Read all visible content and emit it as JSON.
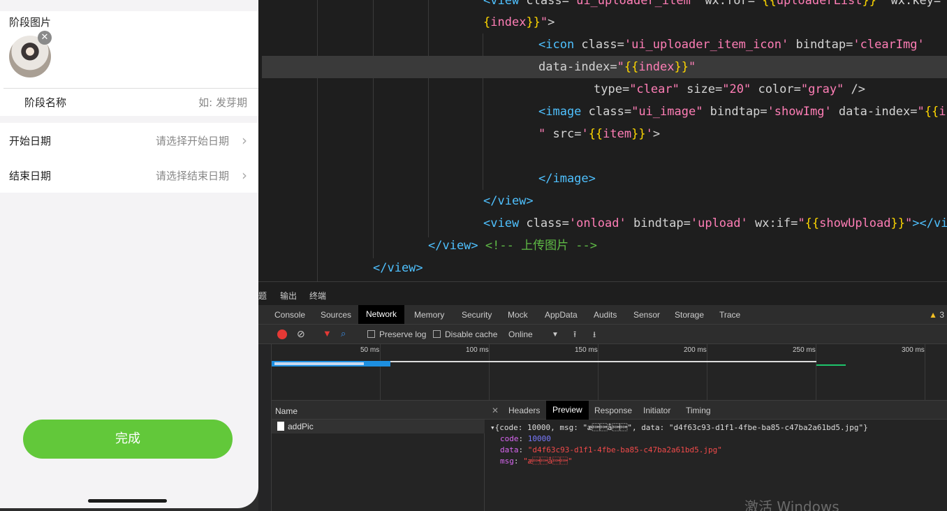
{
  "phone": {
    "stage_pic_label": "阶段图片",
    "avatar_clear_icon": "✕",
    "stage_name_label": "阶段名称",
    "stage_name_placeholder": "如: 发芽期",
    "start_date_label": "开始日期",
    "start_date_placeholder": "请选择开始日期",
    "end_date_label": "结束日期",
    "end_date_placeholder": "请选择结束日期",
    "chevron": "›",
    "done_button": "完成",
    "accent": "#62c83a"
  },
  "editor": {
    "lines": [
      {
        "segments": [
          [
            "c-tag",
            "<view "
          ],
          [
            "c-attr",
            "class="
          ],
          [
            "c-str",
            "'ui_uploader_item'"
          ],
          [
            "c-attr",
            " wx:for="
          ],
          [
            "c-str",
            "\""
          ],
          [
            "c-brace",
            "{{"
          ],
          [
            "c-var",
            "uploaderList"
          ],
          [
            "c-brace",
            "}}"
          ],
          [
            "c-str",
            "\""
          ],
          [
            "c-attr",
            " wx:key="
          ],
          [
            "c-str",
            "\""
          ],
          [
            "c-brace",
            "{"
          ]
        ]
      },
      {
        "segments": [
          [
            "c-brace",
            "{"
          ],
          [
            "c-var",
            "index"
          ],
          [
            "c-brace",
            "}}"
          ],
          [
            "c-str",
            "\""
          ],
          [
            "c-attr",
            ">"
          ]
        ]
      },
      {
        "segments": [
          [
            "c-tag",
            "<icon "
          ],
          [
            "c-attr",
            "class="
          ],
          [
            "c-str",
            "'ui_uploader_item_icon'"
          ],
          [
            "c-attr",
            " bindtap="
          ],
          [
            "c-str",
            "'clearImg'"
          ]
        ]
      },
      {
        "segments": [
          [
            "c-attr",
            "data-index="
          ],
          [
            "c-str",
            "\""
          ],
          [
            "c-brace",
            "{{"
          ],
          [
            "c-var",
            "index"
          ],
          [
            "c-brace",
            "}}"
          ],
          [
            "c-str",
            "\""
          ]
        ]
      },
      {
        "segments": [
          [
            "c-attr",
            "type="
          ],
          [
            "c-str",
            "\"clear\""
          ],
          [
            "c-attr",
            " size="
          ],
          [
            "c-str",
            "\"20\""
          ],
          [
            "c-attr",
            " color="
          ],
          [
            "c-str",
            "\"gray\""
          ],
          [
            "c-attr",
            " />"
          ]
        ]
      },
      {
        "segments": [
          [
            "c-tag",
            "<image "
          ],
          [
            "c-attr",
            "class="
          ],
          [
            "c-str",
            "\"ui_image\""
          ],
          [
            "c-attr",
            " bindtap="
          ],
          [
            "c-str",
            "'showImg'"
          ],
          [
            "c-attr",
            " data-index="
          ],
          [
            "c-str",
            "\""
          ],
          [
            "c-brace",
            "{{"
          ],
          [
            "c-var",
            "ind"
          ]
        ]
      },
      {
        "segments": [
          [
            "c-str",
            "\""
          ],
          [
            "c-attr",
            " src="
          ],
          [
            "c-str",
            "'"
          ],
          [
            "c-brace",
            "{{"
          ],
          [
            "c-var",
            "item"
          ],
          [
            "c-brace",
            "}}"
          ],
          [
            "c-str",
            "'"
          ],
          [
            "c-attr",
            ">"
          ]
        ]
      },
      {
        "segments": []
      },
      {
        "segments": [
          [
            "c-tag",
            "</image>"
          ]
        ]
      },
      {
        "segments": [
          [
            "c-tag",
            "</view>"
          ]
        ]
      },
      {
        "segments": [
          [
            "c-tag",
            "<view "
          ],
          [
            "c-attr",
            "class="
          ],
          [
            "c-str",
            "'onload'"
          ],
          [
            "c-attr",
            " bindtap="
          ],
          [
            "c-str",
            "'upload'"
          ],
          [
            "c-attr",
            " wx:if="
          ],
          [
            "c-str",
            "\""
          ],
          [
            "c-brace",
            "{{"
          ],
          [
            "c-var",
            "showUpload"
          ],
          [
            "c-brace",
            "}}"
          ],
          [
            "c-str",
            "\""
          ],
          [
            "c-tag",
            "></view"
          ]
        ]
      },
      {
        "segments": [
          [
            "c-tag",
            "</view>"
          ],
          [
            "c-com",
            " <!-- 上传图片 -->"
          ]
        ]
      },
      {
        "segments": [
          [
            "c-tag",
            "</view>"
          ]
        ]
      }
    ]
  },
  "devtools": {
    "subtabs": [
      "题",
      "输出",
      "终端"
    ],
    "tabs": [
      "Console",
      "Sources",
      "Network",
      "Memory",
      "Security",
      "Mock",
      "AppData",
      "Audits",
      "Sensor",
      "Storage",
      "Trace"
    ],
    "active_tab": "Network",
    "warning_count": "3",
    "toolbar": {
      "preserve_log": "Preserve log",
      "disable_cache": "Disable cache",
      "throttle": "Online"
    },
    "timeline_ticks": [
      "50 ms",
      "100 ms",
      "150 ms",
      "200 ms",
      "250 ms",
      "300 ms"
    ],
    "request_list": {
      "header": "Name",
      "rows": [
        "addPic"
      ]
    },
    "detail_tabs": [
      "Headers",
      "Preview",
      "Response",
      "Initiator",
      "Timing"
    ],
    "active_detail_tab": "Preview",
    "preview": {
      "summary": "{code: 10000, msg: \"æ\u0001\u0001å\u0001\u0001\", data: \"d4f63c93-d1f1-4fbe-ba85-c47ba2a61bd5.jpg\"}",
      "code_key": "code",
      "code_val": "10000",
      "data_key": "data",
      "data_val": "\"d4f63c93-d1f1-4fbe-ba85-c47ba2a61bd5.jpg\"",
      "msg_key": "msg",
      "msg_val": "\"æ\u0001\u0001å\u0001\u0001\""
    }
  },
  "watermark": "激活 Windows"
}
